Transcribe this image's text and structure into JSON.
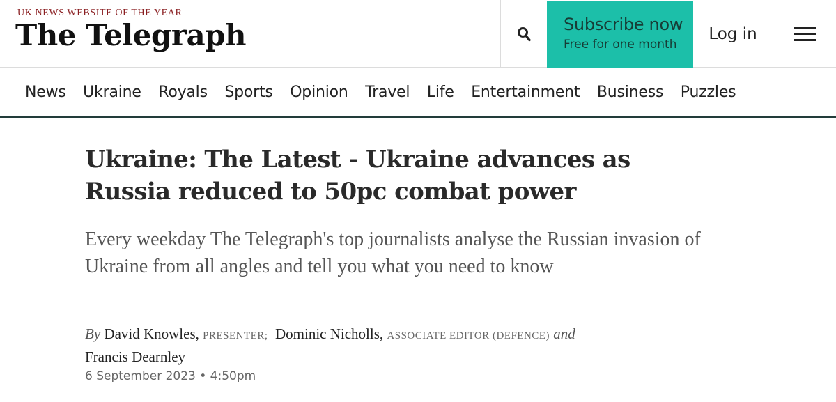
{
  "header": {
    "tagline": "UK NEWS WEBSITE OF THE YEAR",
    "masthead": "The Telegraph",
    "search_icon": "search-icon",
    "subscribe_label": "Subscribe now",
    "subscribe_sub": "Free for one month",
    "login_label": "Log in",
    "menu_icon": "hamburger-menu-icon"
  },
  "nav": {
    "items": [
      "News",
      "Ukraine",
      "Royals",
      "Sports",
      "Opinion",
      "Travel",
      "Life",
      "Entertainment",
      "Business",
      "Puzzles"
    ]
  },
  "article": {
    "headline": "Ukraine: The Latest - Ukraine advances as Russia reduced to 50pc combat power",
    "standfirst": "Every weekday The Telegraph's top journalists analyse the Russian invasion of Ukraine from all angles and tell you what you need to know",
    "byline": {
      "by": "By",
      "author1": "David Knowles,",
      "role1": "Presenter;",
      "author2": "Dominic Nicholls,",
      "role2": "Associate Editor (Defence)",
      "and": "and",
      "author3": "Francis Dearnley"
    },
    "date": "6 September 2023 • 4:50pm"
  },
  "colors": {
    "tagline": "#8a1f22",
    "subscribe_bg": "#1cbfa9",
    "nav_border": "#223c3a"
  }
}
